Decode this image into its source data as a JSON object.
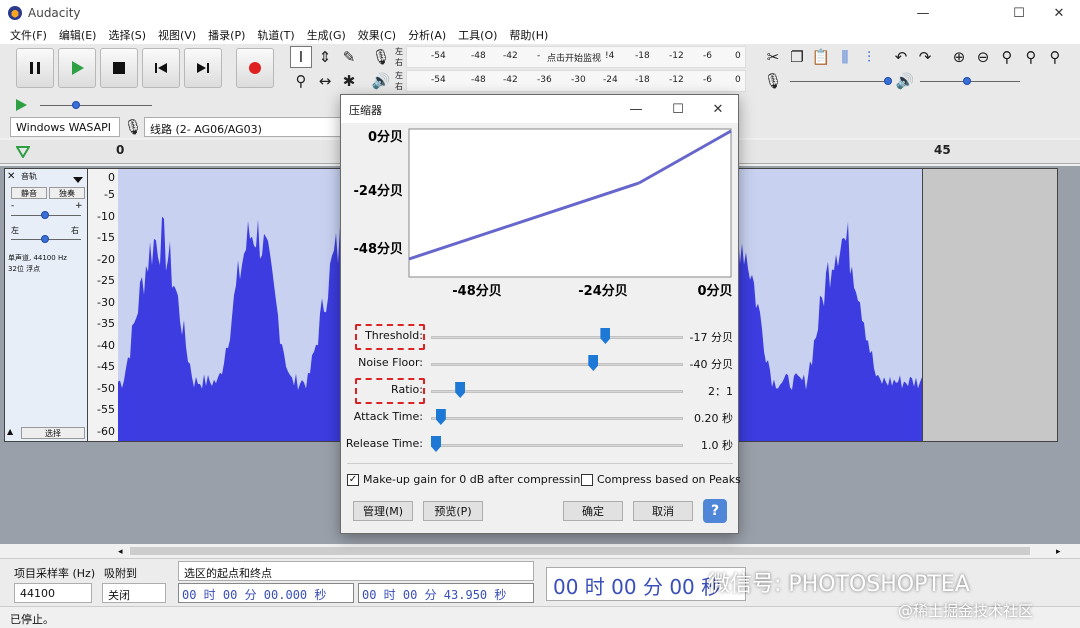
{
  "window": {
    "title": "Audacity",
    "minimize_icon": "—",
    "maximize_icon": "☐",
    "close_icon": "✕"
  },
  "menu": [
    "文件(F)",
    "编辑(E)",
    "选择(S)",
    "视图(V)",
    "播录(P)",
    "轨道(T)",
    "生成(G)",
    "效果(C)",
    "分析(A)",
    "工具(O)",
    "帮助(H)"
  ],
  "meters": {
    "record_ticks": [
      "-54",
      "-48",
      "-42",
      "-",
      "点击开始监视",
      "!4",
      "-18",
      "-12",
      "-6",
      "0"
    ],
    "play_ticks": [
      "-54",
      "-48",
      "-42",
      "-36",
      "-30",
      "-24",
      "-18",
      "-12",
      "-6",
      "0"
    ],
    "channel_left": "左",
    "channel_right": "右"
  },
  "device": {
    "host": "Windows WASAPI",
    "input": "线路 (2- AG06/AG03)"
  },
  "ruler": {
    "start": "0",
    "end_label": "45"
  },
  "track": {
    "name": "音轨",
    "mute": "静音",
    "solo": "独奏",
    "gain_minus": "-",
    "gain_plus": "+",
    "pan_left": "左",
    "pan_right": "右",
    "info_line1": "单声道, 44100 Hz",
    "info_line2": "32位 浮点",
    "select": "选择",
    "scale": [
      "0",
      "-5",
      "-10",
      "-15",
      "-20",
      "-25",
      "-30",
      "-35",
      "-40",
      "-45",
      "-50",
      "-55",
      "-60"
    ]
  },
  "bottom": {
    "rate_label": "项目采样率 (Hz)",
    "rate_value": "44100",
    "snap_label": "吸附到",
    "snap_value": "关闭",
    "selection_label": "选区的起点和终点",
    "start_time": "00 时 00 分 00.000 秒",
    "end_time": "00 时 00 分 43.950 秒",
    "big_time": "00 时 00 分 00 秒"
  },
  "status": "已停止。",
  "watermarks": {
    "wechat": "微信号: PHOTOSHOPTEA",
    "juejin": "@稀土掘金技术社区"
  },
  "dialog": {
    "title": "压缩器",
    "graph": {
      "y_labels": [
        "0分贝",
        "-24分贝",
        "-48分贝"
      ],
      "x_labels": [
        "-48分贝",
        "-24分贝",
        "0分贝"
      ]
    },
    "sliders": [
      {
        "label": "Threshold:",
        "value": "-17 分贝",
        "position": 0.7
      },
      {
        "label": "Noise Floor:",
        "value": "-40 分贝",
        "position": 0.65
      },
      {
        "label": "Ratio:",
        "value": "2：1",
        "position": 0.1
      },
      {
        "label": "Attack Time:",
        "value": "0.20 秒",
        "position": 0.02
      },
      {
        "label": "Release Time:",
        "value": "1.0 秒",
        "position": 0.0
      }
    ],
    "makeup_gain": "Make-up gain for 0 dB after compressing",
    "makeup_checked": "✓",
    "peaks": "Compress based on Peaks",
    "manage": "管理(M)",
    "preview": "预览(P)",
    "ok": "确定",
    "cancel": "取消",
    "help": "?"
  },
  "colors": {
    "wave": "#3c3ce0",
    "wave_bg": "#c8d2f0",
    "accent": "#1e78d6",
    "annotation": "#d22222"
  }
}
